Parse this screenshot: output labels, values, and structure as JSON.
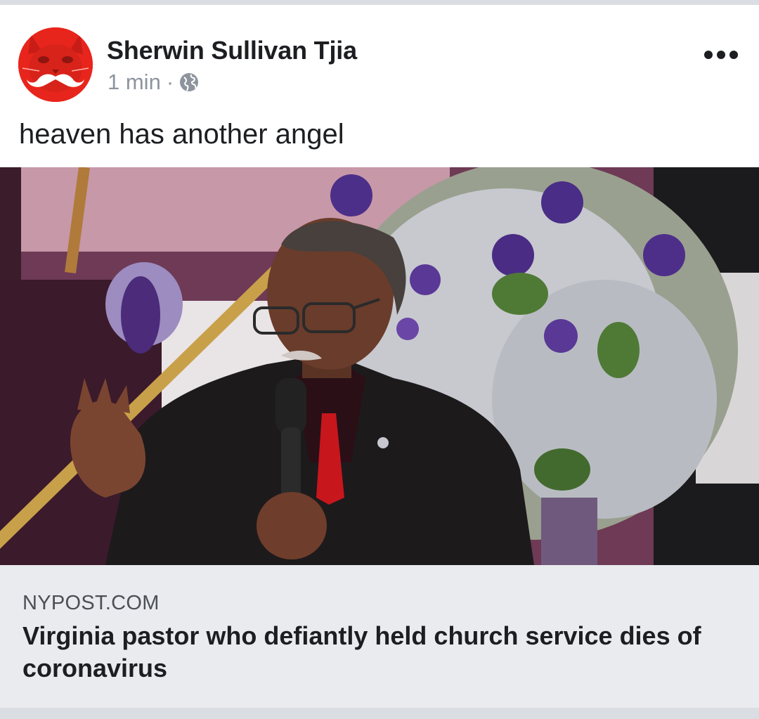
{
  "post": {
    "author": "Sherwin Sullivan Tjia",
    "time": "1 min",
    "separator": "·",
    "privacy_icon": "globe-icon",
    "menu_icon": "more-options-icon",
    "text": "heaven has another angel"
  },
  "avatar": {
    "icon": "red-cat-mustache-avatar",
    "color": "#e8251c"
  },
  "photo": {
    "description_icon": "article-photo"
  },
  "link": {
    "domain": "NYPOST.COM",
    "headline": "Virginia pastor who defiantly held church service dies of coronavirus"
  },
  "colors": {
    "background": "#dadde1",
    "card": "#ffffff",
    "link_card": "#eaebef",
    "meta_gray": "#8d949e",
    "text": "#1c1e21"
  }
}
